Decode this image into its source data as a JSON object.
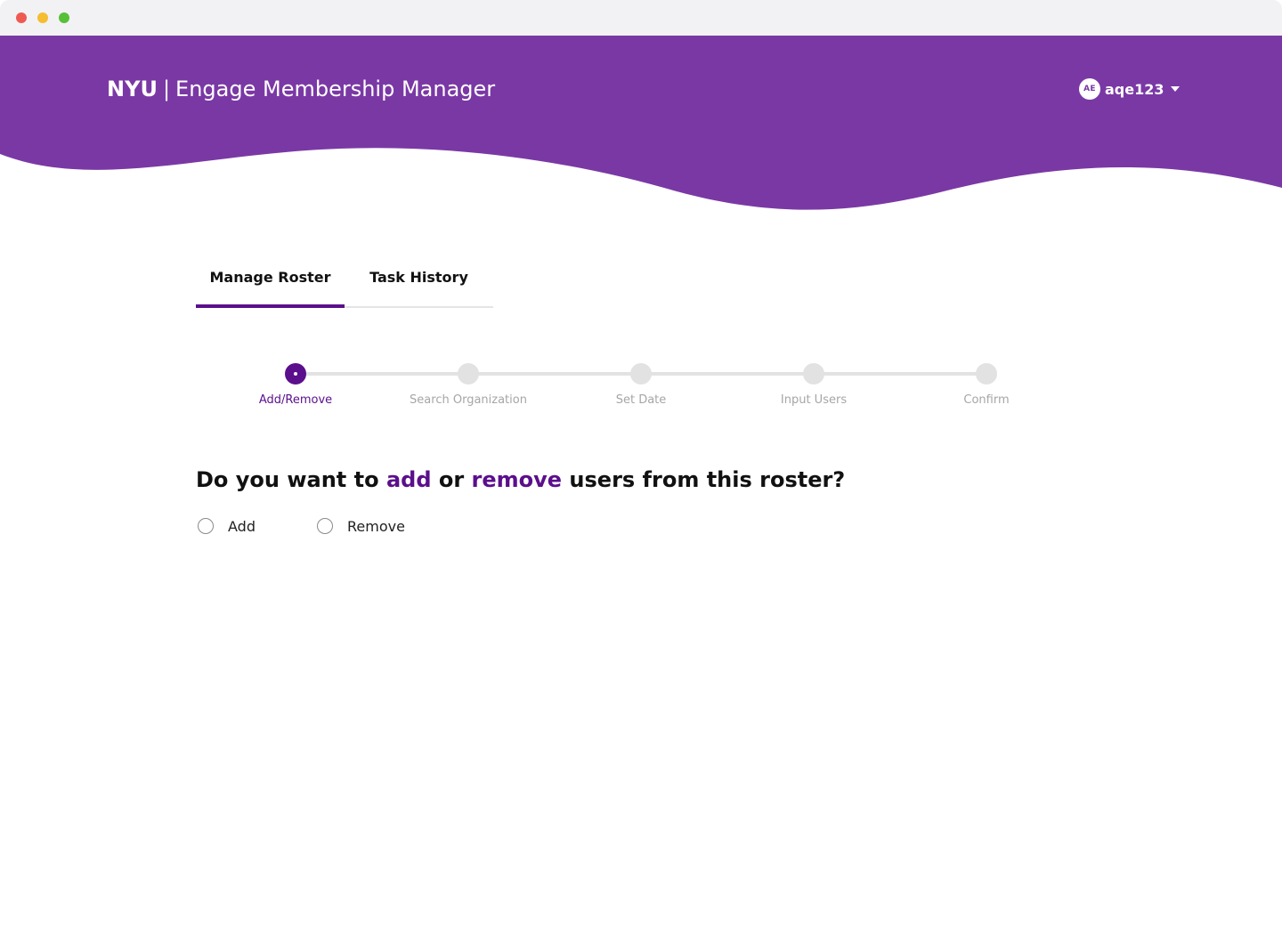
{
  "header": {
    "brand_strong": "NYU",
    "brand_separator": "|",
    "brand_app": "Engage Membership Manager",
    "bg_color": "#7a38a5"
  },
  "user": {
    "initials": "AE",
    "username": "aqe123"
  },
  "tabs": [
    {
      "label": "Manage Roster",
      "active": true
    },
    {
      "label": "Task History",
      "active": false
    }
  ],
  "stepper": {
    "current_index": 0,
    "steps": [
      {
        "label": "Add/Remove"
      },
      {
        "label": "Search Organization"
      },
      {
        "label": "Set Date"
      },
      {
        "label": "Input Users"
      },
      {
        "label": "Confirm"
      }
    ]
  },
  "question": {
    "part1": "Do you want to ",
    "accent1": "add",
    "part2": " or ",
    "accent2": "remove",
    "part3": " users from this roster?"
  },
  "options": [
    {
      "label": "Add",
      "selected": false
    },
    {
      "label": "Remove",
      "selected": false
    }
  ],
  "colors": {
    "accent": "#5b0f8c",
    "header": "#7a38a5",
    "inactive_step": "#e2e2e2"
  }
}
